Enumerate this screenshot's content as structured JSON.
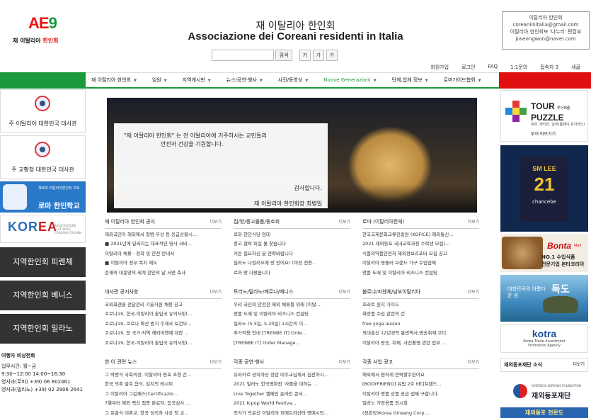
{
  "header": {
    "logo_mark": "AE",
    "logo_text_a": "재 이탈리아 ",
    "logo_text_b": "한인회",
    "title_ko": "재 이탈리아 한인회",
    "title_it": "Associazione dei Coreani residenti in Italia",
    "search_button": "검색",
    "font_sizes": [
      "가",
      "가",
      "가"
    ],
    "contact": {
      "line1": "이탈리아 한인회",
      "line2": "coreaniinitalia@gmail.com",
      "line3": "이탈리아 한인회보 '나누리' 편집부",
      "line4": "joseongwon@naver.com"
    },
    "util_nav": [
      "회원가입",
      "로그인",
      "FAQ",
      "1:1문의",
      "접속자 3",
      "새글"
    ]
  },
  "nav": {
    "items": [
      "재 이탈리아 한인회",
      "임원",
      "지역게시판",
      "뉴스/공연·행사",
      "사진/동영상",
      "Nuove Generazioni",
      "단체,업체 정보",
      "로마가이드협회"
    ]
  },
  "left": {
    "embassy1": "주 이탈리아 대한민국 대사관",
    "embassy2": "주 교황청 대한민국 대사관",
    "school_small": "재로마 이탈리아한인회 지회",
    "school_big": "로마 한인학교",
    "korea_logo_a": "KOR",
    "korea_logo_b": "EA",
    "korea_sub": "ASSOCIAZIONE CULTURALE COREANA ITALIANA",
    "regions": [
      "지역한인회 피렌체",
      "지역한인회 베니스",
      "지역한인회 밀라노"
    ],
    "emergency": {
      "title": "여행자 비상전화",
      "lines": [
        "업무시간: 월~금",
        "9:30~12:00 14:00~16:30",
        "영사과(로마) +39) 06 802461",
        "영사과(밀라노) +39) 02 2906 2641"
      ]
    }
  },
  "hero": {
    "line1": "\"재 이탈리아 한인회\" 는 전 이탈리아에 거주하시는 교민들의",
    "line2": "안전과 건강을 기원합니다.",
    "sig1": "감사합니다.",
    "sig2": "재 이탈리아 한인회장 최병일"
  },
  "boards": [
    {
      "title": "재 이탈리아 한인회 공지",
      "more": "더보기",
      "rows": [
        "재외국민이 해외에서 질병·부상 등 응급상황시...",
        "■ 2021년에 달라지는 대표적인 영사 서비...",
        "이탈리아 체류 · 정착 및 안전 안내서",
        "■ 이탈리아 정부 폭지 제도",
        "존재의 대흥망의 세계 한인의 날 서면 축사"
      ]
    },
    {
      "title": "집/방/중고물품/동호회",
      "more": "더보기",
      "rows": [
        "로마 한인식당 임대",
        "중고 협탁 피실 볼 찾습니다",
        "커튼 필요하신 분 연락바랍니다",
        "밀라노 나빌리오에 방 있어요! (여성 전용...",
        "로마 방 나왔습니다"
      ]
    },
    {
      "title": "로마 (이탈리아전체)",
      "more": "더보기",
      "rows": [
        "한국국제문화교류진흥원 (KOFICE) 해외통신...",
        "2021 재외동포 국내교육과정 수학생 모집(...",
        "식품의약품안전처 해외정보리포터 모집 공고",
        "이탈리아 영플러 브랜드 가구 수입업체",
        "명품 도매 및 이탈리아 비즈니스 컨설팅"
      ]
    },
    {
      "title": "대사관 공지사항",
      "more": "더보기",
      "rows": [
        "국외화견을 전달관리 기술자원 채용 공고",
        "코로나19, 한국-이탈리아 출입국 유의사항(...",
        "코로나19, 코로나 확산 방지 주재국 보건부...",
        "코로나19, 전 국가·지역 해외여행에 대한 ...",
        "코로나19, 한국-이탈리아 출입국 유의사항(..."
      ]
    },
    {
      "title": "토리노/밀라노/베로나/베니스",
      "more": "더보기",
      "rows": [
        "우리 국민의 안전한 해외 체류를 위해 [이탈...",
        "명품 도매 및 이탈리아 비즈니스 컨설팅",
        "밀라노 (5.5일, 5.20일) 1시간의 이...",
        "추가적용 안내 [TRENBE IT] Orde...",
        "[TRENBE IT] Order Manage..."
      ]
    },
    {
      "title": "볼로냐/피렌체/남부이탈리아",
      "more": "더보기",
      "rows": [
        "프라토 원지 가이드",
        "화장품 수입 관련의 건",
        "free yoga lesson",
        "외대출신 12년경력 통번역사,방송취재 코디",
        "이탈리아 방송, 취재, 사진촬영 관련 업무 ..."
      ]
    },
    {
      "title": "한·이 관련 뉴스",
      "more": "더보기",
      "rows": [
        "그 박병석 국회의장, 이탈리아 등포 초청 간...",
        "한국 의추 발효 음식, 김치의 레시피",
        "그 이탈리아 그린패스(Certificazio...",
        "7월부터 해외 백신 접종 완료자, 입국심사 ...",
        "그 유출식 대추교, 한국 성직자 사상 첫 교..."
      ]
    },
    {
      "title": "각종 공연·행사",
      "more": "더보기",
      "rows": [
        "유라카르 성직자상 장관 대주교님께서 집전하시...",
        "2021 밀라노 한국영화전 '사를을 대하는 ...",
        "Live Together 캠페인 온라인 콘서...",
        "2021 K-pop World Festiva...",
        "조각가 박은선 이탈리아 피에트라산타 명예시민..."
      ]
    },
    {
      "title": "각종 사업 광고",
      "more": "더보기",
      "rows": [
        "해외에서 편하게 연락할수있어요",
        "[BODYFRIEND] 유럽 2호 바디프렌드...",
        "이탈리아 명품 상품 공급 업체 구합니다.",
        "밀라노 가정용품 전시회",
        "(정관장)Korea Ginseng Corp...."
      ]
    }
  ],
  "right": {
    "puzzle_title_a": "TOUR",
    "puzzle_title_b": "PUZZLE",
    "puzzle_small": "투어퍼즐",
    "puzzle_sub": "로마, 바티칸, 남부(폼페이,포지타노)",
    "puzzle_btn": "투어 바로가기",
    "jersey_name": "SM LEE",
    "jersey_number": "21",
    "jersey_brand": "chancebe",
    "bonta_brand": "Bonta",
    "bonta_mall": "Mall",
    "bonta_l1": "NO.1 수입식품",
    "bonta_l2": "전문기업 본타코리아",
    "dokdo_small": "대한민국의 아름다운 섬",
    "dokdo_big": "독도",
    "kotra": "kotra",
    "kotra_sub1": "Korea Trade-Investment",
    "kotra_sub2": "Promotion Agency",
    "foundation_title": "재외동포재단 소식",
    "foundation_more": "더보기",
    "foundation_small": "OVERSEAS KOREANS FOUNDATION",
    "foundation_name": "재외동포재단",
    "edu_banner": "재외동포 전문도"
  }
}
